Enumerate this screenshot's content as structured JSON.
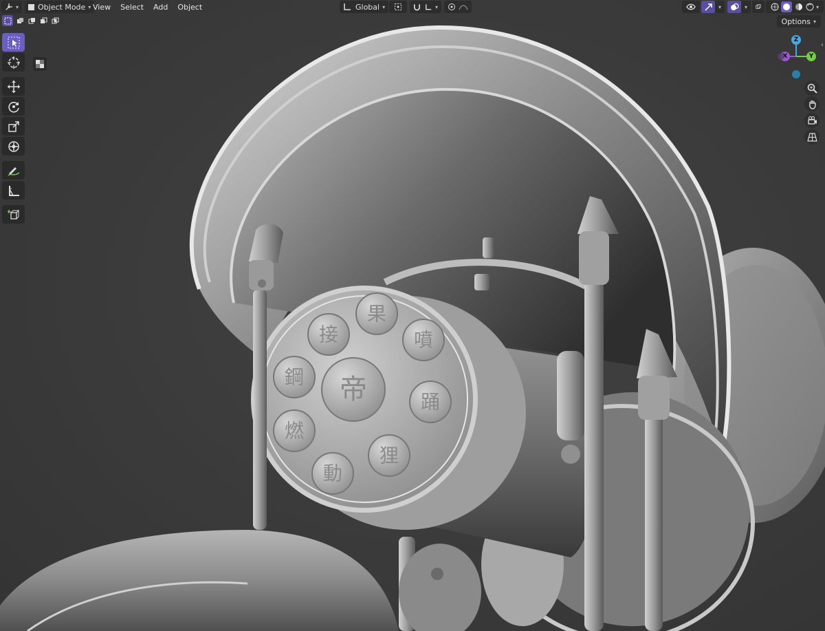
{
  "header": {
    "mode_label": "Object Mode",
    "menus": [
      "View",
      "Select",
      "Add",
      "Object"
    ],
    "transform_orientation": "Global"
  },
  "options_label": "Options",
  "gizmo": {
    "z": "Z",
    "x": "X",
    "y": "Y"
  },
  "emblem_glyphs": [
    "接",
    "果",
    "噴",
    "踊",
    "狸",
    "動",
    "燃",
    "鋼",
    "帝"
  ],
  "colors": {
    "background": "#3a3a3a",
    "accent": "#6a5fc1",
    "axis_x": "#9b59d0",
    "axis_y": "#6fcf3f",
    "axis_z": "#4aa8e0"
  },
  "icons": {
    "editor_type": "axis-editor-icon",
    "select_box": "select-box-icon",
    "cursor": "cursor-icon",
    "move": "move-icon",
    "rotate": "rotate-icon",
    "scale": "scale-icon",
    "transform": "transform-icon",
    "annotate": "annotate-icon",
    "measure": "measure-icon",
    "add_cube": "add-cube-icon"
  }
}
